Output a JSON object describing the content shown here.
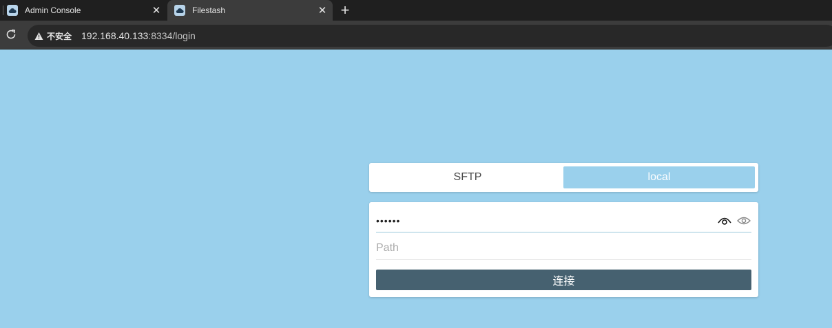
{
  "browser": {
    "tabs": [
      {
        "title": "Admin Console",
        "active": false,
        "close": "✕"
      },
      {
        "title": "Filestash",
        "active": true,
        "close": "✕"
      }
    ],
    "new_tab": "+",
    "security_label": "不安全",
    "url_host": "192.168.40.133",
    "url_rest": ":8334/login"
  },
  "login": {
    "protocols": [
      {
        "label": "SFTP",
        "selected": false
      },
      {
        "label": "local",
        "selected": true
      }
    ],
    "password_masked": "••••••",
    "path_placeholder": "Path",
    "submit_label": "连接"
  },
  "colors": {
    "background": "#9ad0ec",
    "button": "#466170",
    "selected_tab": "#9ad0ec"
  }
}
